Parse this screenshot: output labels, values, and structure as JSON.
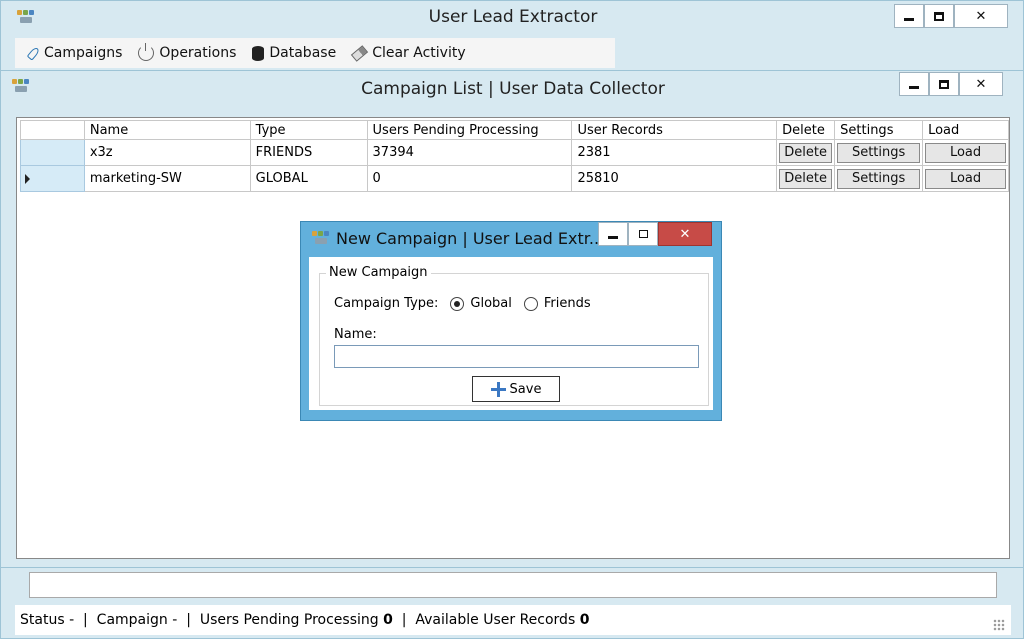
{
  "main_window": {
    "title": "User Lead Extractor",
    "toolbar": [
      {
        "label": "Campaigns",
        "icon": "rocket-icon"
      },
      {
        "label": "Operations",
        "icon": "power-icon"
      },
      {
        "label": "Database",
        "icon": "database-icon"
      },
      {
        "label": "Clear Activity",
        "icon": "eraser-icon"
      }
    ]
  },
  "list_window": {
    "title": "Campaign List | User Data Collector",
    "columns": [
      "Name",
      "Type",
      "Users Pending Processing",
      "User Records",
      "Delete",
      "Settings",
      "Load"
    ],
    "rows": [
      {
        "name": "x3z",
        "type": "FRIENDS",
        "pending": "37394",
        "records": "2381",
        "delete": "Delete",
        "settings": "Settings",
        "load": "Load",
        "selected": false
      },
      {
        "name": "marketing-SW",
        "type": "GLOBAL",
        "pending": "0",
        "records": "25810",
        "delete": "Delete",
        "settings": "Settings",
        "load": "Load",
        "selected": true
      }
    ]
  },
  "dialog": {
    "title": "New Campaign | User Lead Extr...",
    "group_label": "New Campaign",
    "type_label": "Campaign Type:",
    "options": [
      "Global",
      "Friends"
    ],
    "selected_option": "Global",
    "name_label": "Name:",
    "name_value": "",
    "save_label": "Save"
  },
  "status": {
    "status_label": "Status",
    "status_value": "-",
    "campaign_label": "Campaign",
    "campaign_value": "-",
    "pending_label": "Users Pending Processing",
    "pending_value": "0",
    "available_label": "Available User Records",
    "available_value": "0"
  },
  "colors": {
    "window_bg": "#d7e9f1",
    "dialog_frame": "#62b0dc",
    "close_red": "#c74b47",
    "row_header": "#d6ebf7"
  }
}
